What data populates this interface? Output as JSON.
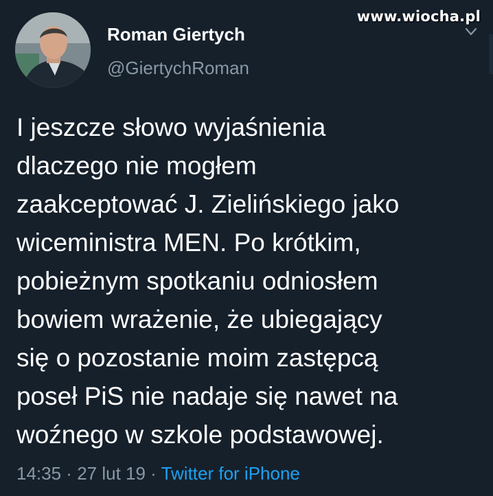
{
  "watermark": "www.wiocha.pl",
  "tweet": {
    "author_name": "Roman Giertych",
    "author_handle": "@GiertychRoman",
    "text": "I jeszcze słowo wyjaśnienia\ndlaczego nie mogłem\nzaakceptować J. Zielińskiego jako\nwiceministra MEN. Po krótkim,\npobieżnym spotkaniu odniosłem\nbowiem wrażenie, że ubiegający\nsię o pozostanie moim zastępcą\nposeł PiS nie nadaje się nawet na\nwoźnego w szkole podstawowej.",
    "time": "14:35",
    "separator_1": " · ",
    "date": "27 lut 19",
    "separator_2": " · ",
    "source": "Twitter for iPhone"
  },
  "icons": {
    "menu": "chevron-down-icon"
  },
  "colors": {
    "background": "#16202b",
    "primary_text": "#ffffff",
    "secondary_text": "#8899a6",
    "link": "#1da1f2"
  }
}
